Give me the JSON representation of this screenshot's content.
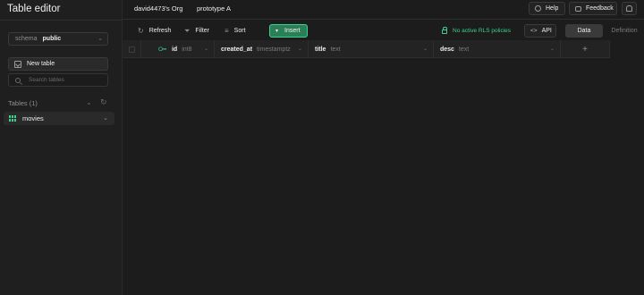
{
  "sidebar": {
    "title": "Table editor",
    "schema_label": "schema",
    "schema_value": "public",
    "new_table_label": "New table",
    "search_placeholder": "Search tables",
    "tables_heading": "Tables (1)",
    "tables": [
      {
        "label": "movies"
      }
    ]
  },
  "topbar": {
    "org": "david4473's Org",
    "project": "prototype A",
    "help_label": "Help",
    "feedback_label": "Feedback"
  },
  "toolbar": {
    "refresh_label": "Refresh",
    "filter_label": "Filter",
    "sort_label": "Sort",
    "insert_label": "Insert",
    "rls_label": "No active RLS policies",
    "api_label": "API",
    "data_tab": "Data",
    "definition_tab": "Definition"
  },
  "grid": {
    "columns": [
      {
        "name": "id",
        "type": "int8"
      },
      {
        "name": "created_at",
        "type": "timestamptz"
      },
      {
        "name": "title",
        "type": "text"
      },
      {
        "name": "desc",
        "type": "text"
      }
    ],
    "add_symbol": "+"
  },
  "colors": {
    "accent": "#3ecf8e",
    "insert_bg": "#2a7f56",
    "background": "#1c1c1c"
  }
}
